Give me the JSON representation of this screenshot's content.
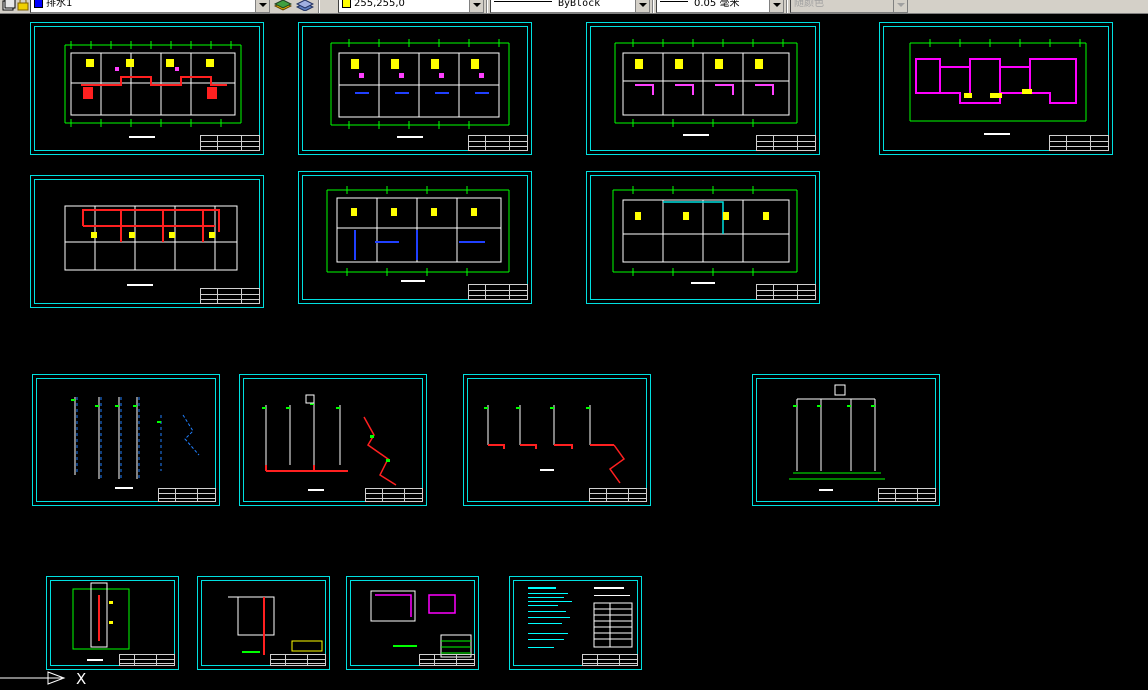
{
  "toolbar": {
    "layer_name": "排水1",
    "color_value": "255,255,0",
    "linetype_value": "ByBlock",
    "lineweight_value": "0.05 毫米",
    "plotstyle_value": "随颜色",
    "colors": {
      "layer_swatch": "#0000ff",
      "color_swatch": "#ffff00"
    }
  },
  "drawing": {
    "background": "#000000",
    "sheet_border_color": "#00e0e0",
    "sheets": [
      {
        "id": "plan-1",
        "kind": "floor-plan"
      },
      {
        "id": "plan-2",
        "kind": "floor-plan"
      },
      {
        "id": "plan-3",
        "kind": "floor-plan"
      },
      {
        "id": "plan-4",
        "kind": "floor-plan"
      },
      {
        "id": "plan-5",
        "kind": "floor-plan"
      },
      {
        "id": "plan-6",
        "kind": "floor-plan"
      },
      {
        "id": "plan-7",
        "kind": "floor-plan"
      },
      {
        "id": "riser-1",
        "kind": "riser-diagram"
      },
      {
        "id": "riser-2",
        "kind": "riser-diagram"
      },
      {
        "id": "riser-3",
        "kind": "riser-diagram"
      },
      {
        "id": "riser-4",
        "kind": "riser-diagram"
      },
      {
        "id": "detail-1",
        "kind": "detail"
      },
      {
        "id": "detail-2",
        "kind": "detail"
      },
      {
        "id": "detail-3",
        "kind": "detail"
      },
      {
        "id": "notes-1",
        "kind": "notes-table"
      }
    ],
    "ucs_axis_label": "X"
  }
}
